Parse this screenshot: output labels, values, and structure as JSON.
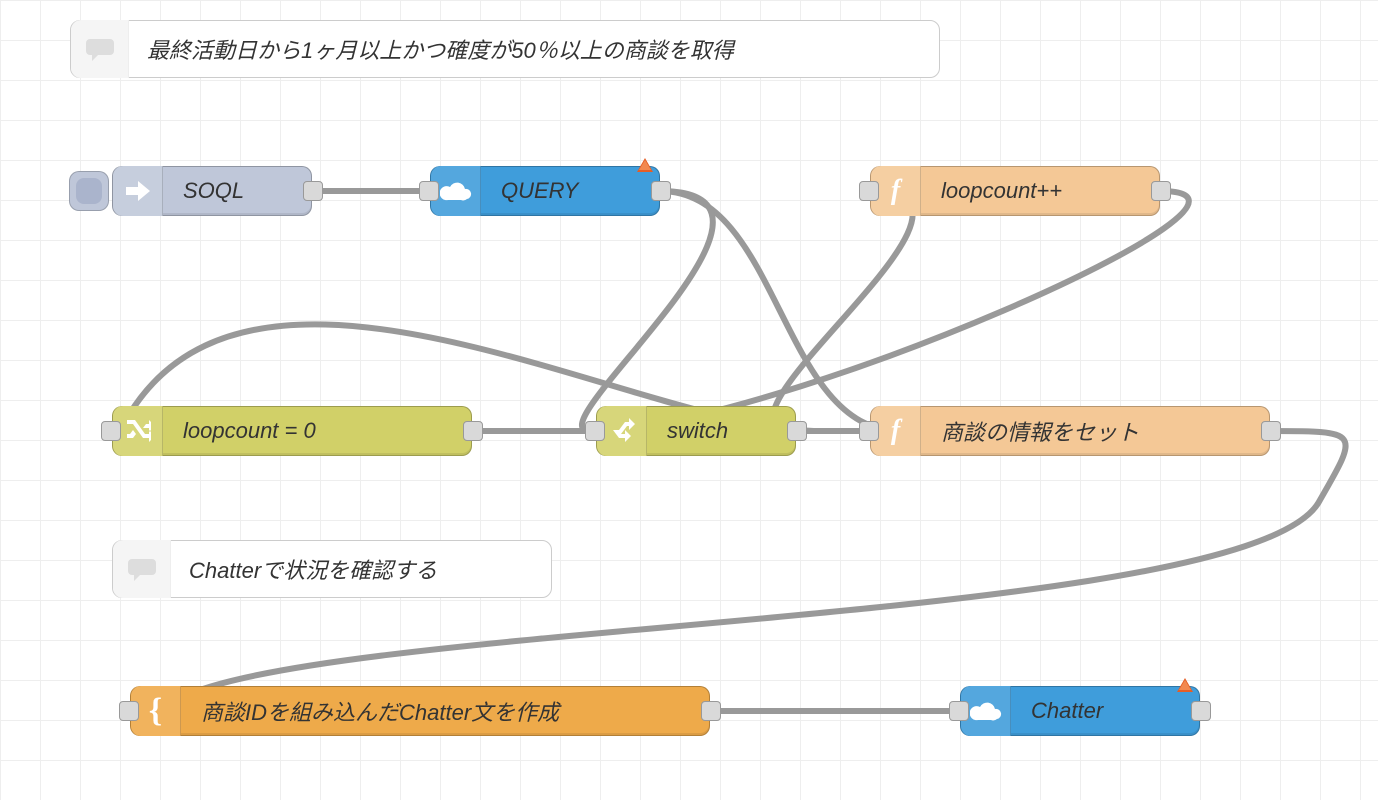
{
  "comments": {
    "top": "最終活動日から1ヶ月以上かつ確度が50％以上の商談を取得",
    "mid": "Chatterで状況を確認する"
  },
  "nodes": {
    "inject": {
      "label": "SOQL"
    },
    "query": {
      "label": "QUERY"
    },
    "loopInc": {
      "label": "loopcount++"
    },
    "loopInit": {
      "label": "loopcount = 0"
    },
    "switch": {
      "label": "switch"
    },
    "setInfo": {
      "label": "商談の情報をセット"
    },
    "template": {
      "label": "商談IDを組み込んだChatter文を作成"
    },
    "chatter": {
      "label": "Chatter"
    }
  }
}
